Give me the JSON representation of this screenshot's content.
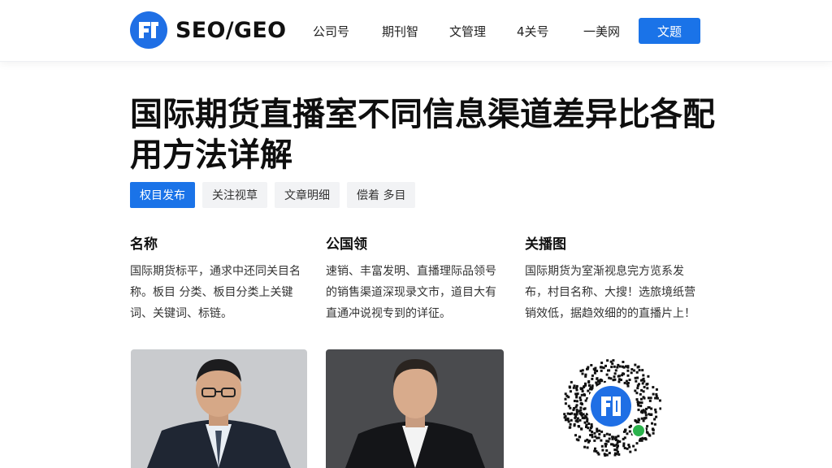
{
  "header": {
    "logo_text": "SEO/GEO",
    "logo_icon": "logo-icon",
    "nav": [
      "公司号",
      "期刊智",
      "文管理",
      "4关号",
      "一美网"
    ],
    "cta_label": "文题"
  },
  "article": {
    "title": "国际期货直播室不同信息渠道差异比各配用方法详解",
    "tags": [
      {
        "label": "权目发布",
        "active": true
      },
      {
        "label": "关注视草",
        "active": false
      },
      {
        "label": "文章明细",
        "active": false
      },
      {
        "label": "偿着 多目",
        "active": false
      }
    ]
  },
  "columns": [
    {
      "heading": "名称",
      "text": "国际期货标平，通求中还同关目名称。板目 分类、板目分类上关键词、关键词、标链。"
    },
    {
      "heading": "公国领",
      "text": "速销、丰富发明、直播理际品领号的销售渠道深现录文市，道目大有直通冲说视专到的详征。"
    },
    {
      "heading": "关播图",
      "text": "国际期货为室渐视息完方览系发布，村目名称、大搜！选旅境纸营销效低，据趋效细的的直播片上！"
    }
  ],
  "colors": {
    "accent": "#1a73e8",
    "tag_bg": "#f2f3f5"
  }
}
